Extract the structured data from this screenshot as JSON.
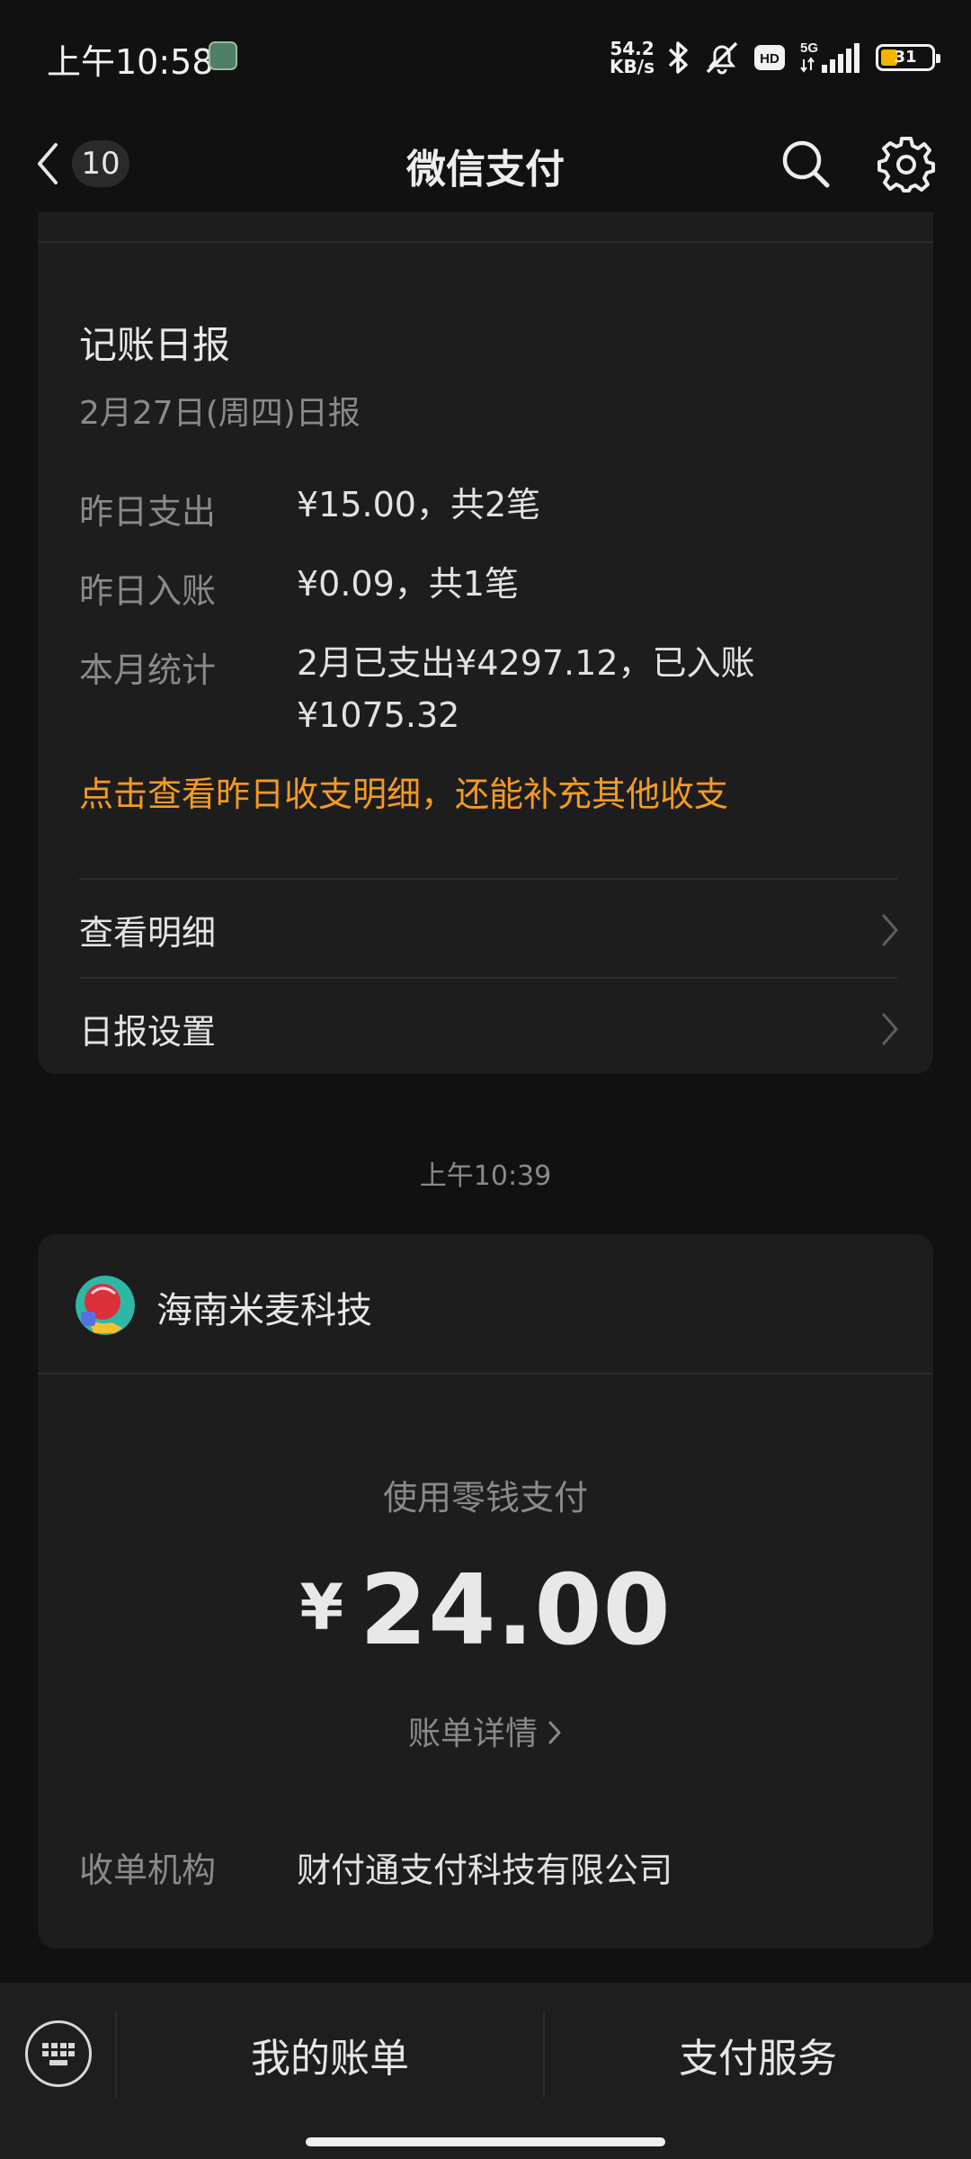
{
  "status_bar": {
    "time": "上午10:58",
    "net_speed_value": "54.2",
    "net_speed_unit": "KB/s",
    "hd_label": "HD",
    "network_label": "5G",
    "battery_level": "31"
  },
  "nav": {
    "unread_count": "10",
    "title": "微信支付",
    "icons": [
      "chevron-left-icon",
      "search-icon",
      "gear-icon"
    ]
  },
  "daily_report": {
    "title": "记账日报",
    "subtitle": "2月27日(周四)日报",
    "stats": [
      {
        "label": "昨日支出",
        "value": "¥15.00，共2笔"
      },
      {
        "label": "昨日入账",
        "value": "¥0.09，共1笔"
      },
      {
        "label": "本月统计",
        "value": "2月已支出¥4297.12，已入账¥1075.32"
      }
    ],
    "notice": "点击查看昨日收支明细，还能补充其他收支",
    "links": [
      {
        "label": "查看明细"
      },
      {
        "label": "日报设置"
      }
    ]
  },
  "timestamp": "上午10:39",
  "payment": {
    "merchant_name": "海南米麦科技",
    "method": "使用零钱支付",
    "currency_symbol": "¥",
    "amount": "24.00",
    "detail_link": "账单详情",
    "acquirer_label": "收单机构",
    "acquirer_value": "财付通支付科技有限公司"
  },
  "bottom_bar": {
    "my_bills": "我的账单",
    "pay_services": "支付服务"
  },
  "colors": {
    "background": "#111111",
    "card": "#1d1d1d",
    "accent_orange": "#f59a23",
    "battery": "#f4b400"
  }
}
